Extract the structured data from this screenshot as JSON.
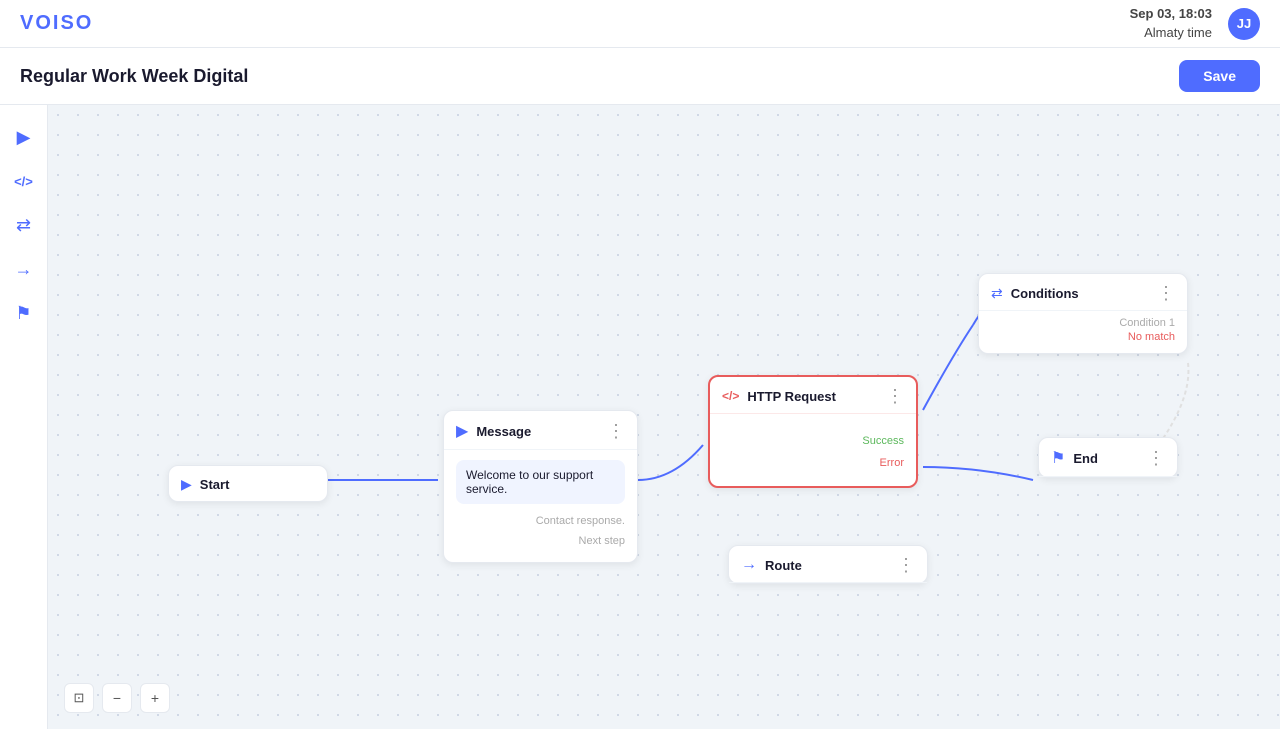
{
  "app": {
    "logo": "VOISO",
    "datetime": "Sep 03, 18:03",
    "timezone": "Almaty time",
    "avatar_initials": "JJ"
  },
  "header": {
    "title": "Regular Work Week Digital",
    "save_label": "Save"
  },
  "sidebar_tools": [
    {
      "name": "play-icon",
      "symbol": "▶"
    },
    {
      "name": "code-icon",
      "symbol": "</>"
    },
    {
      "name": "transfer-icon",
      "symbol": "⇄"
    },
    {
      "name": "arrow-icon",
      "symbol": "→"
    },
    {
      "name": "flag-icon",
      "symbol": "⚑"
    }
  ],
  "nodes": {
    "start": {
      "title": "Start",
      "icon": "▶"
    },
    "message": {
      "title": "Message",
      "icon": "▶",
      "body": "Welcome to our support service.",
      "contact_response": "Contact response.",
      "next_step": "Next step"
    },
    "http_request": {
      "title": "HTTP Request",
      "icon": "</>",
      "success_label": "Success",
      "error_label": "Error"
    },
    "conditions": {
      "title": "Conditions",
      "condition_label": "Condition 1",
      "no_match": "No match"
    },
    "end": {
      "title": "End",
      "icon": "⚑"
    },
    "route": {
      "title": "Route",
      "icon": "→"
    }
  },
  "canvas_controls": {
    "fit_icon": "⊡",
    "zoom_out_icon": "−",
    "zoom_in_icon": "+"
  }
}
